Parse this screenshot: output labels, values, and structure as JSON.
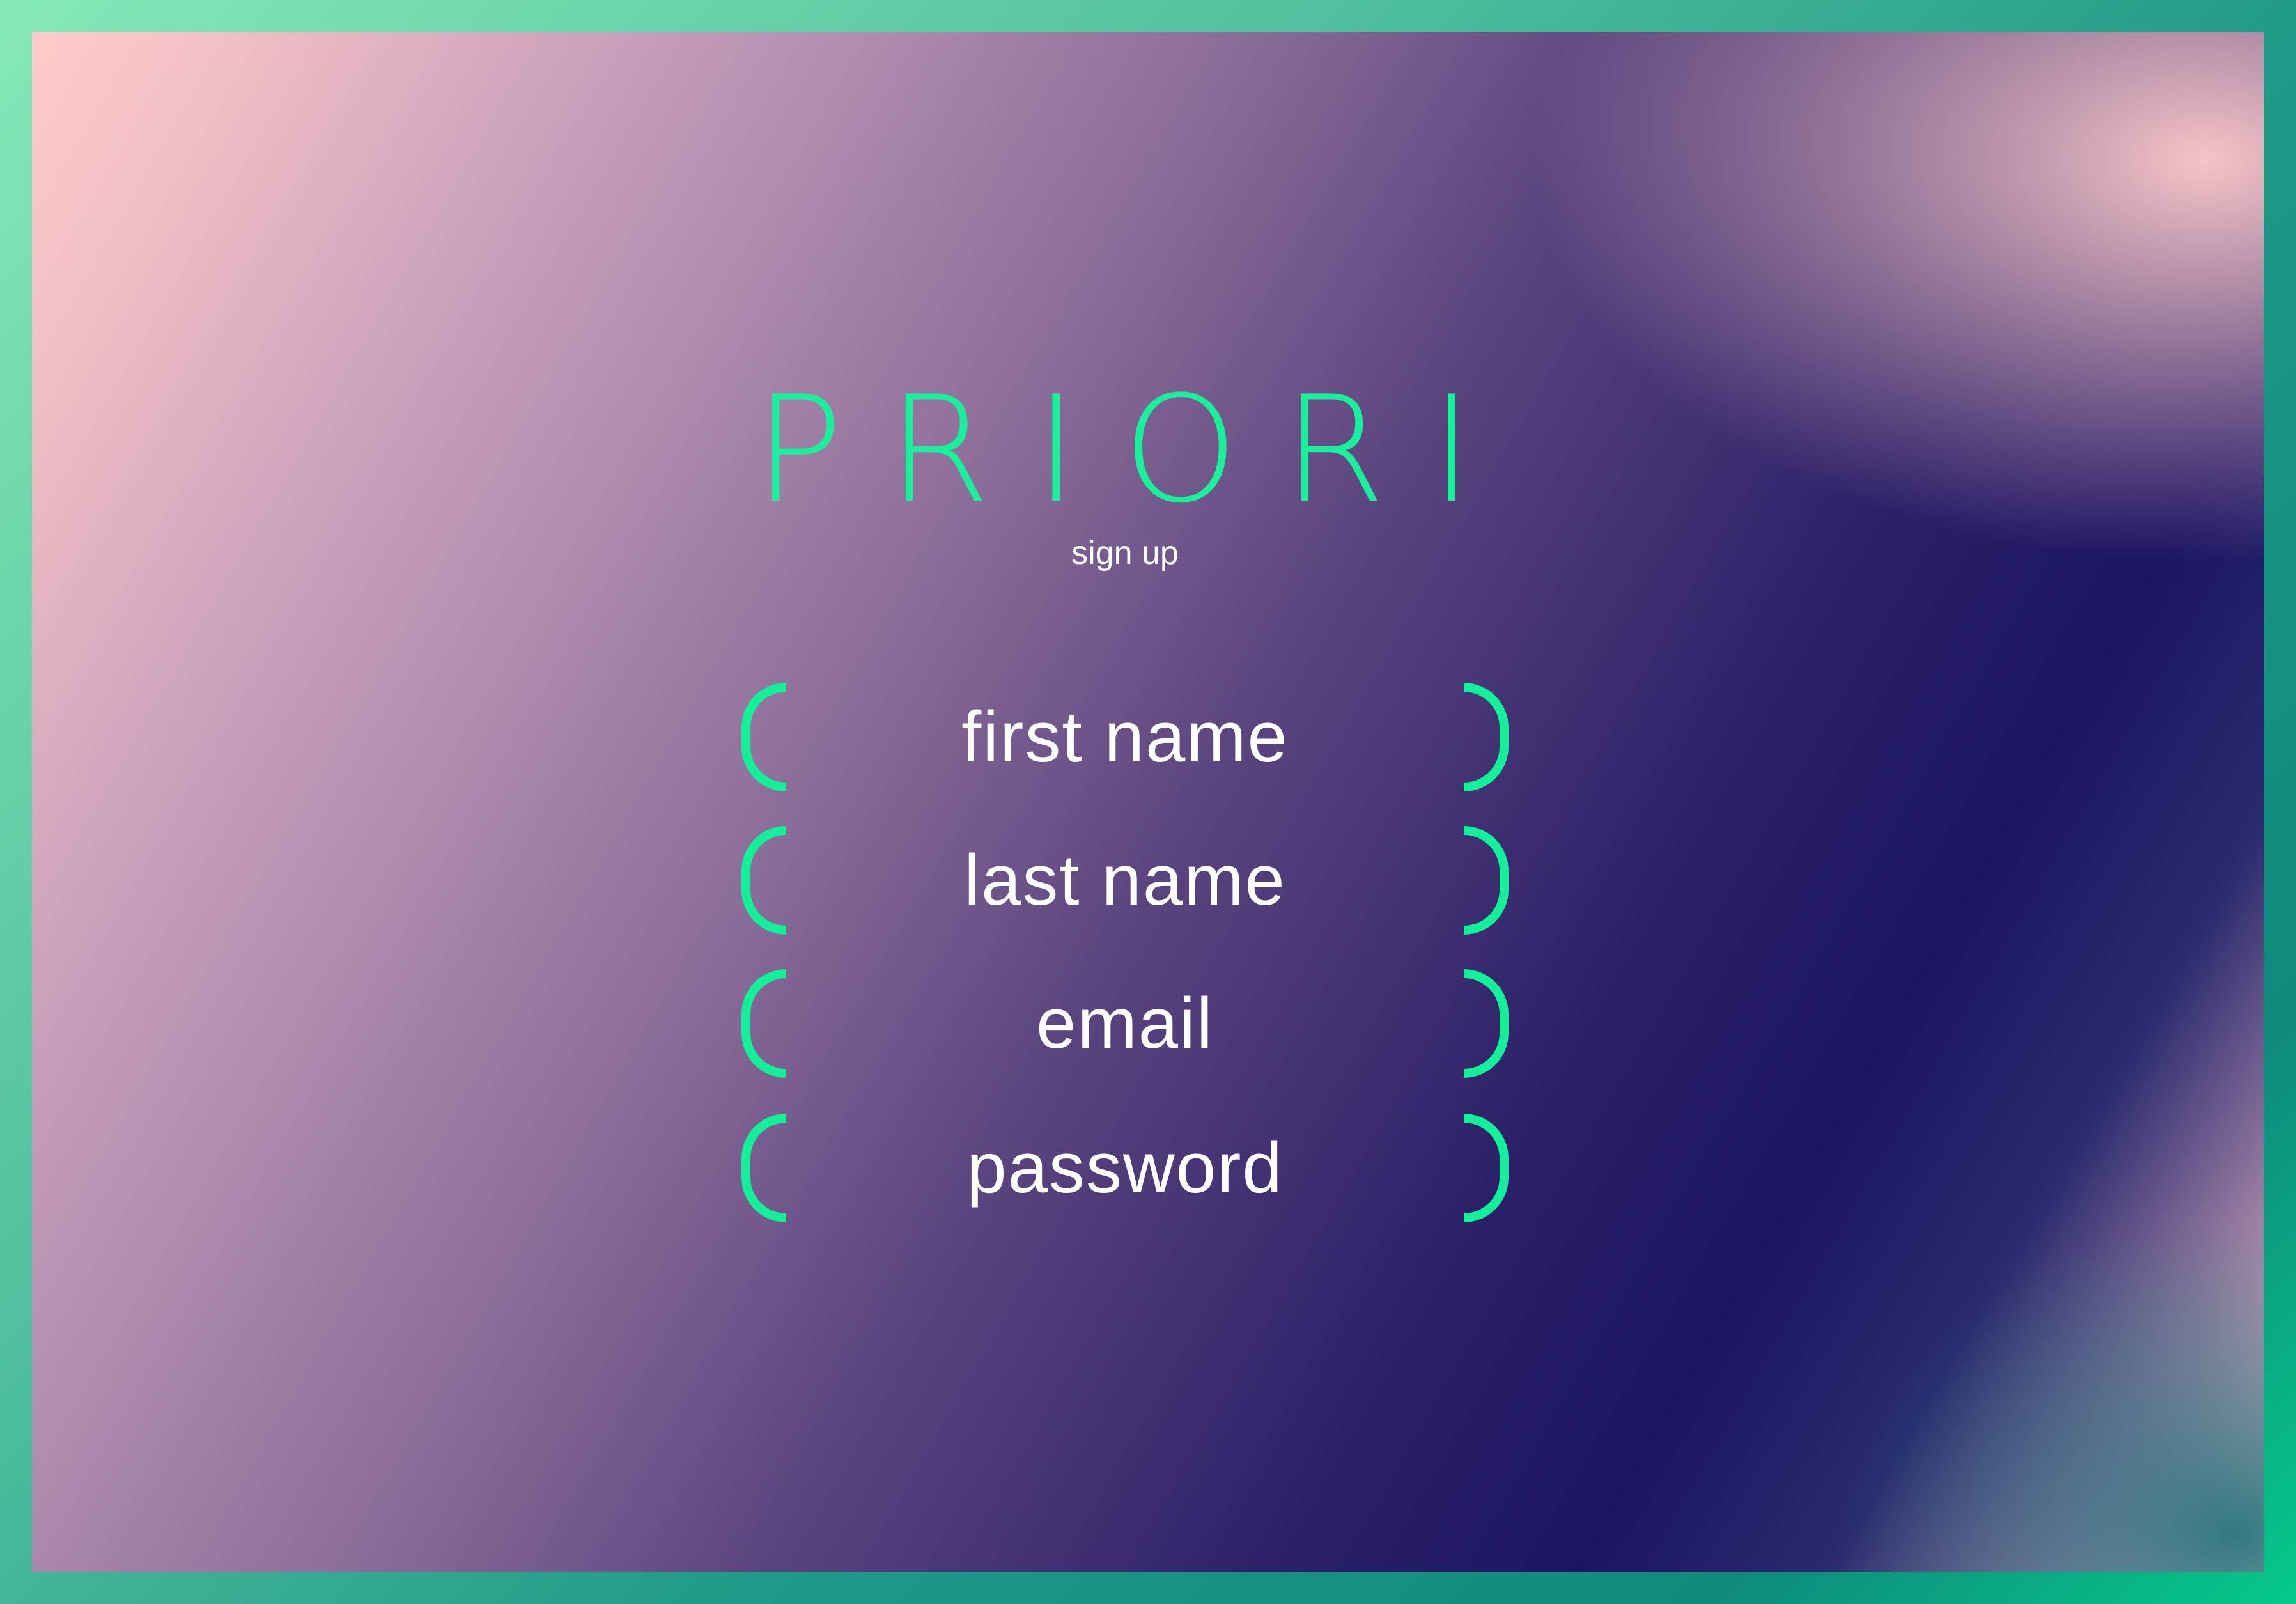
{
  "app": {
    "title": "PRIORI",
    "subtitle": "sign up"
  },
  "form": {
    "fields": [
      {
        "label": "first name"
      },
      {
        "label": "last name"
      },
      {
        "label": "email"
      },
      {
        "label": "password"
      }
    ]
  },
  "colors": {
    "accent": "#1af09b",
    "text": "#ffffff",
    "frame_green": "#4fbf9d",
    "background_pink": "#ffcbc9",
    "background_navy": "#1d1564"
  }
}
